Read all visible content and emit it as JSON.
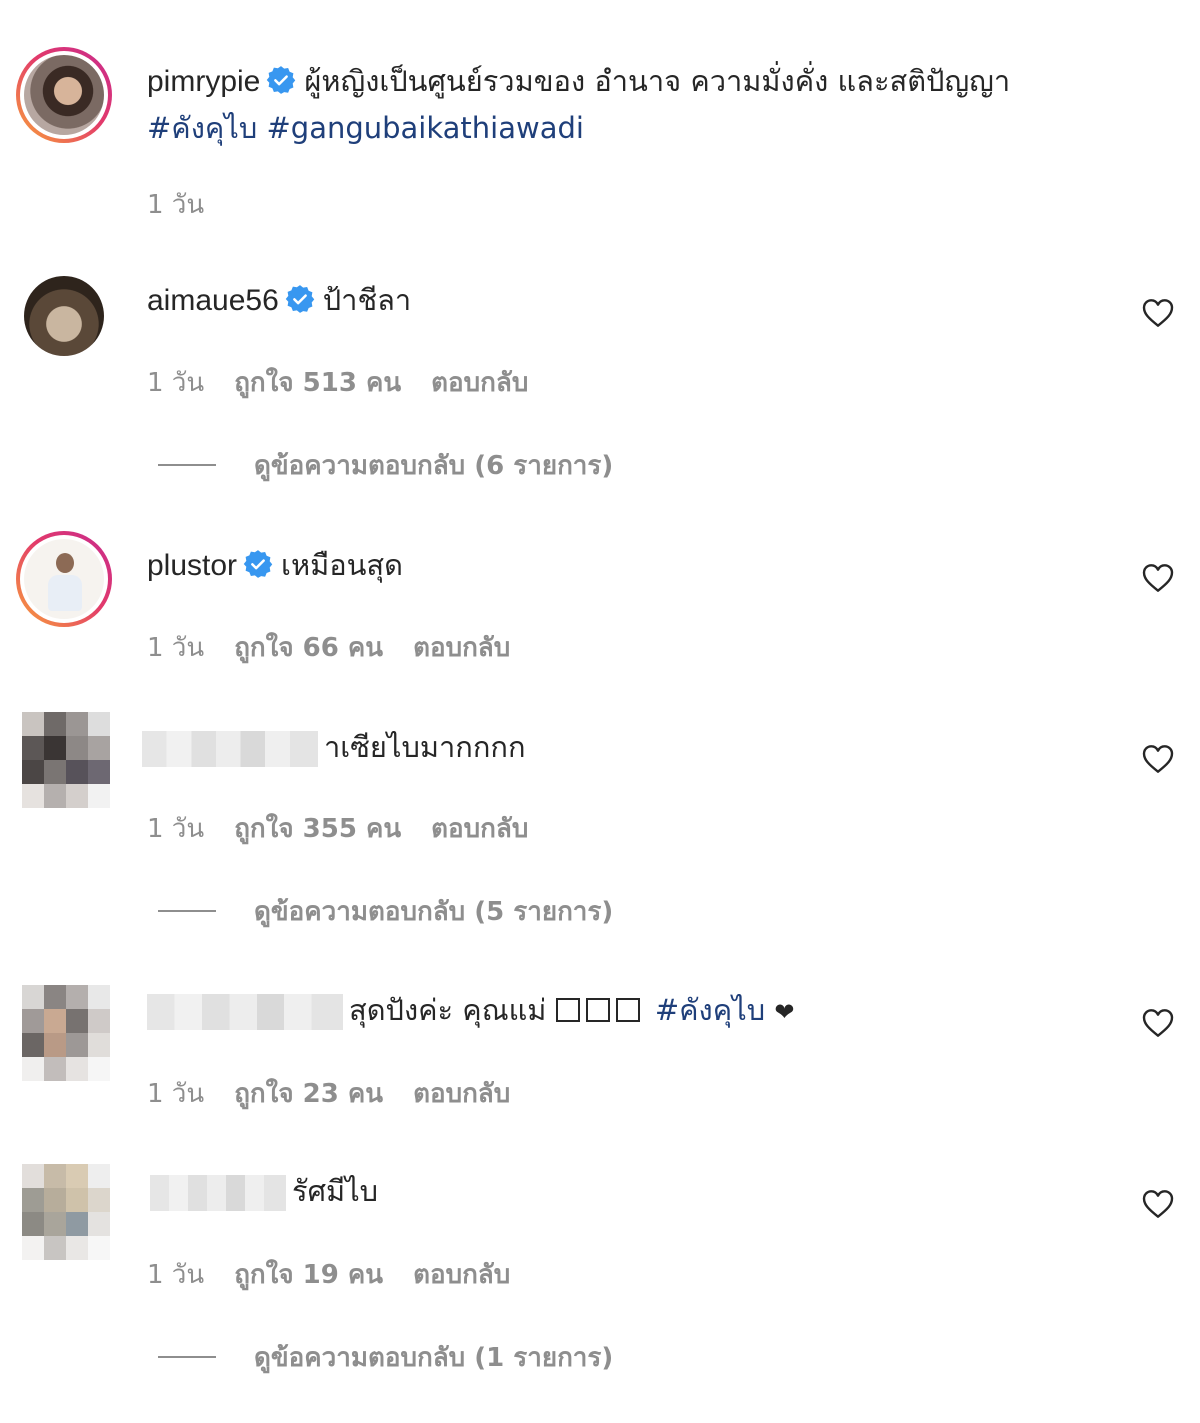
{
  "post": {
    "username": "pimrypie",
    "caption": "ผู้หญิงเป็นศูนย์รวมของ อำนาจ ความมั่งคั่ง และสติปัญญา",
    "hashtag1": "#คังคุไบ",
    "hashtag2": "#gangubaikathiawadi",
    "time": "1 วัน"
  },
  "comments": [
    {
      "username": "aimaue56",
      "text": "ป้าชีลา",
      "time": "1 วัน",
      "likes": "ถูกใจ 513 คน",
      "reply": "ตอบกลับ",
      "view_replies": "ดูข้อความตอบกลับ (6 รายการ)"
    },
    {
      "username": "plustor",
      "text": "เหมือนสุด",
      "time": "1 วัน",
      "likes": "ถูกใจ 66 คน",
      "reply": "ตอบกลับ"
    },
    {
      "text": "าเซียไบมากกกก",
      "time": "1 วัน",
      "likes": "ถูกใจ 355 คน",
      "reply": "ตอบกลับ",
      "view_replies": "ดูข้อความตอบกลับ (5 รายการ)"
    },
    {
      "text": "สุดปังค่ะ คุณแม่",
      "hashtag": "#คังคุไบ",
      "heart_glyph": "❤",
      "time": "1 วัน",
      "likes": "ถูกใจ 23 คน",
      "reply": "ตอบกลับ"
    },
    {
      "text": "รัศมีไบ",
      "time": "1 วัน",
      "likes": "ถูกใจ 19 คน",
      "reply": "ตอบกลับ",
      "view_replies": "ดูข้อความตอบกลับ (1 รายการ)"
    }
  ],
  "colors": {
    "text": "#262626",
    "meta": "#8e8e8e",
    "hashtag": "#1f3f7a",
    "verified": "#3897f0"
  },
  "icons": {
    "verified": "verified-badge-icon",
    "like": "heart-outline-icon"
  }
}
